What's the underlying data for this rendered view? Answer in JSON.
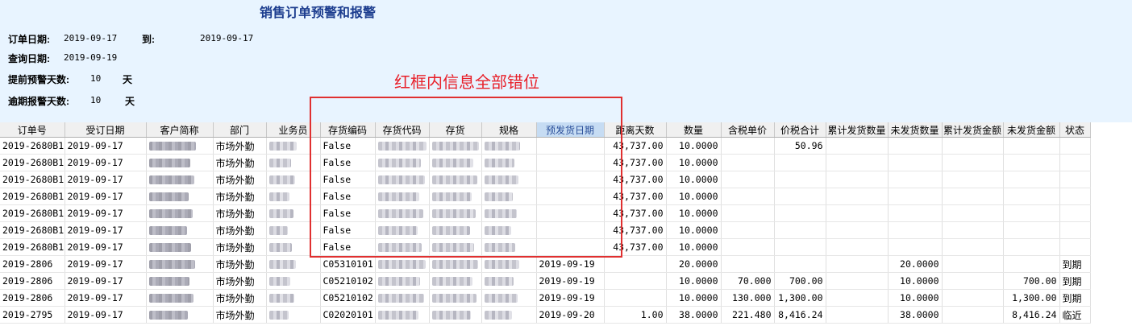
{
  "report": {
    "title": "销售订单预警和报警",
    "order_date_label": "订单日期:",
    "order_date_from": "2019-09-17",
    "to_label": "到:",
    "order_date_to": "2019-09-17",
    "query_date_label": "查询日期:",
    "query_date": "2019-09-19",
    "advance_warn_label": "提前预警天数:",
    "advance_warn_days": "10",
    "overdue_warn_label": "逾期报警天数:",
    "overdue_warn_days": "10",
    "day_unit": "天"
  },
  "annotation": {
    "text": "红框内信息全部错位",
    "color": "#e8202a"
  },
  "colors": {
    "header_bg": "#e8f4ff",
    "title": "#1c3d8f",
    "redbox": "#e03030",
    "selected_header": "#c6dcf3"
  },
  "columns": [
    "订单号",
    "受订日期",
    "客户简称",
    "部门",
    "业务员",
    "存货编码",
    "存货代码",
    "存货",
    "规格",
    "预发货日期",
    "距离天数",
    "数量",
    "含税单价",
    "价税合计",
    "累计发货数量",
    "未发货数量",
    "累计发货金额",
    "未发货金额",
    "状态"
  ],
  "rows": [
    [
      "2019-2680B1",
      "2019-09-17",
      "",
      "市场外勤",
      "",
      "False",
      "",
      "",
      "",
      "",
      "43,737.00",
      "10.0000",
      "",
      "50.96",
      "",
      "",
      "",
      "",
      ""
    ],
    [
      "2019-2680B1",
      "2019-09-17",
      "",
      "市场外勤",
      "",
      "False",
      "",
      "",
      "",
      "",
      "43,737.00",
      "10.0000",
      "",
      "",
      "",
      "",
      "",
      "",
      ""
    ],
    [
      "2019-2680B1",
      "2019-09-17",
      "",
      "市场外勤",
      "",
      "False",
      "",
      "",
      "",
      "",
      "43,737.00",
      "10.0000",
      "",
      "",
      "",
      "",
      "",
      "",
      ""
    ],
    [
      "2019-2680B1",
      "2019-09-17",
      "",
      "市场外勤",
      "",
      "False",
      "",
      "",
      "",
      "",
      "43,737.00",
      "10.0000",
      "",
      "",
      "",
      "",
      "",
      "",
      ""
    ],
    [
      "2019-2680B1",
      "2019-09-17",
      "",
      "市场外勤",
      "",
      "False",
      "",
      "",
      "",
      "",
      "43,737.00",
      "10.0000",
      "",
      "",
      "",
      "",
      "",
      "",
      ""
    ],
    [
      "2019-2680B1",
      "2019-09-17",
      "",
      "市场外勤",
      "",
      "False",
      "",
      "",
      "",
      "",
      "43,737.00",
      "10.0000",
      "",
      "",
      "",
      "",
      "",
      "",
      ""
    ],
    [
      "2019-2680B1",
      "2019-09-17",
      "",
      "市场外勤",
      "",
      "False",
      "",
      "",
      "",
      "",
      "43,737.00",
      "10.0000",
      "",
      "",
      "",
      "",
      "",
      "",
      ""
    ],
    [
      "2019-2806",
      "2019-09-17",
      "",
      "市场外勤",
      "",
      "C05310101",
      "",
      "",
      "",
      "2019-09-19",
      "",
      "20.0000",
      "",
      "",
      "",
      "20.0000",
      "",
      "",
      "到期"
    ],
    [
      "2019-2806",
      "2019-09-17",
      "",
      "市场外勤",
      "",
      "C05210102",
      "",
      "",
      "",
      "2019-09-19",
      "",
      "10.0000",
      "70.000",
      "700.00",
      "",
      "10.0000",
      "",
      "700.00",
      "到期"
    ],
    [
      "2019-2806",
      "2019-09-17",
      "",
      "市场外勤",
      "",
      "C05210102",
      "",
      "",
      "",
      "2019-09-19",
      "",
      "10.0000",
      "130.000",
      "1,300.00",
      "",
      "10.0000",
      "",
      "1,300.00",
      "到期"
    ],
    [
      "2019-2795",
      "2019-09-17",
      "",
      "市场外勤",
      "",
      "C02020101",
      "",
      "",
      "",
      "2019-09-20",
      "1.00",
      "38.0000",
      "221.480",
      "8,416.24",
      "",
      "38.0000",
      "",
      "8,416.24",
      "临近"
    ]
  ]
}
